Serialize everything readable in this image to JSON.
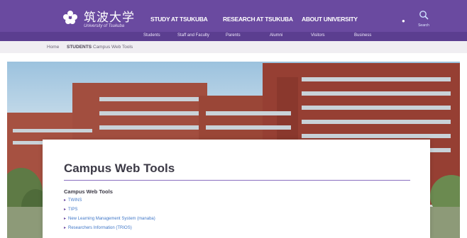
{
  "header": {
    "logo_title": "筑波大学",
    "logo_subtitle": "University of Tsukuba",
    "main_nav": [
      "STUDY AT TSUKUBA",
      "RESEARCH AT TSUKUBA",
      "ABOUT UNIVERSITY"
    ],
    "sub_nav": [
      "Students",
      "Staff and Faculty",
      "Parents",
      "Alumni",
      "Visitors",
      "Business"
    ],
    "search_label": "Search",
    "colors": {
      "primary": "#6a4aa0",
      "subnav": "#5b3e90"
    }
  },
  "breadcrumb": {
    "items": [
      "Home",
      "STUDENTS",
      "Campus Web Tools"
    ]
  },
  "content": {
    "title": "Campus Web Tools",
    "section_title": "Campus Web Tools",
    "links": [
      "TWINS",
      "TIPS",
      "New Learning Management System (manaba)",
      "Researchers Information (TRIOS)"
    ],
    "link_color": "#4178c8"
  }
}
